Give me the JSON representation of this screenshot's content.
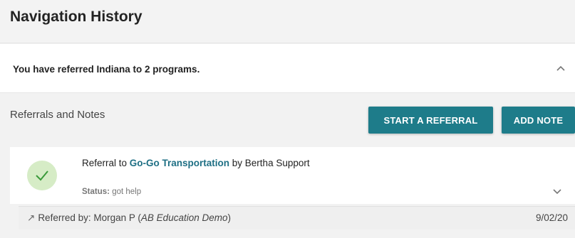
{
  "header": {
    "title": "Navigation History"
  },
  "summary": {
    "text": "You have referred Indiana to 2 programs.",
    "chevron_icon": "chevron-up-icon"
  },
  "referrals": {
    "section_title": "Referrals and Notes",
    "start_referral_label": "START A REFERRAL",
    "add_note_label": "ADD NOTE",
    "button_color": "#1e7c8a",
    "items": [
      {
        "status_icon": "check-icon",
        "title_prefix": "Referral to ",
        "program": "Go-Go Transportation",
        "title_middle": " by ",
        "referrer": "Bertha Support",
        "status_label": "Status:",
        "status_value": "got help",
        "chevron_icon": "chevron-down-icon",
        "referred_by_label": "Referred by:",
        "referred_by_name": "Morgan  P",
        "referred_by_org": "AB Education Demo",
        "date": "9/02/20"
      }
    ]
  }
}
